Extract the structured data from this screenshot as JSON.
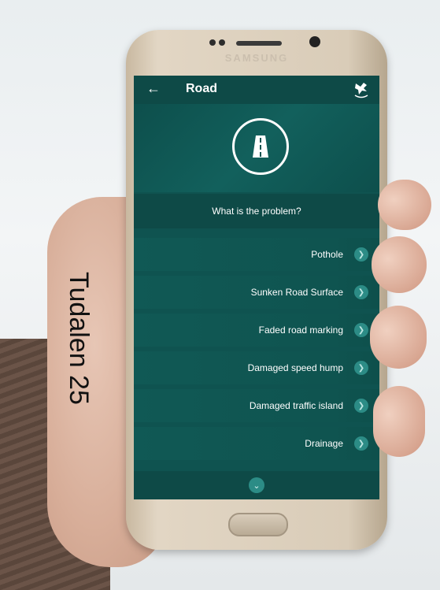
{
  "device": {
    "brand": "SAMSUNG"
  },
  "app": {
    "title": "Road",
    "question": "What is the problem?",
    "items": [
      {
        "label": "Pothole"
      },
      {
        "label": "Sunken Road Surface"
      },
      {
        "label": "Faded road marking"
      },
      {
        "label": "Damaged speed hump"
      },
      {
        "label": "Damaged traffic island"
      },
      {
        "label": "Drainage"
      }
    ]
  },
  "overlay": {
    "page_label": "Tudalen 25"
  },
  "colors": {
    "primary": "#0f5350",
    "accent": "#2c8c86"
  },
  "icons": [
    "back-arrow-icon",
    "council-logo-icon",
    "road-icon",
    "chevron-right-icon",
    "chevron-down-icon"
  ]
}
